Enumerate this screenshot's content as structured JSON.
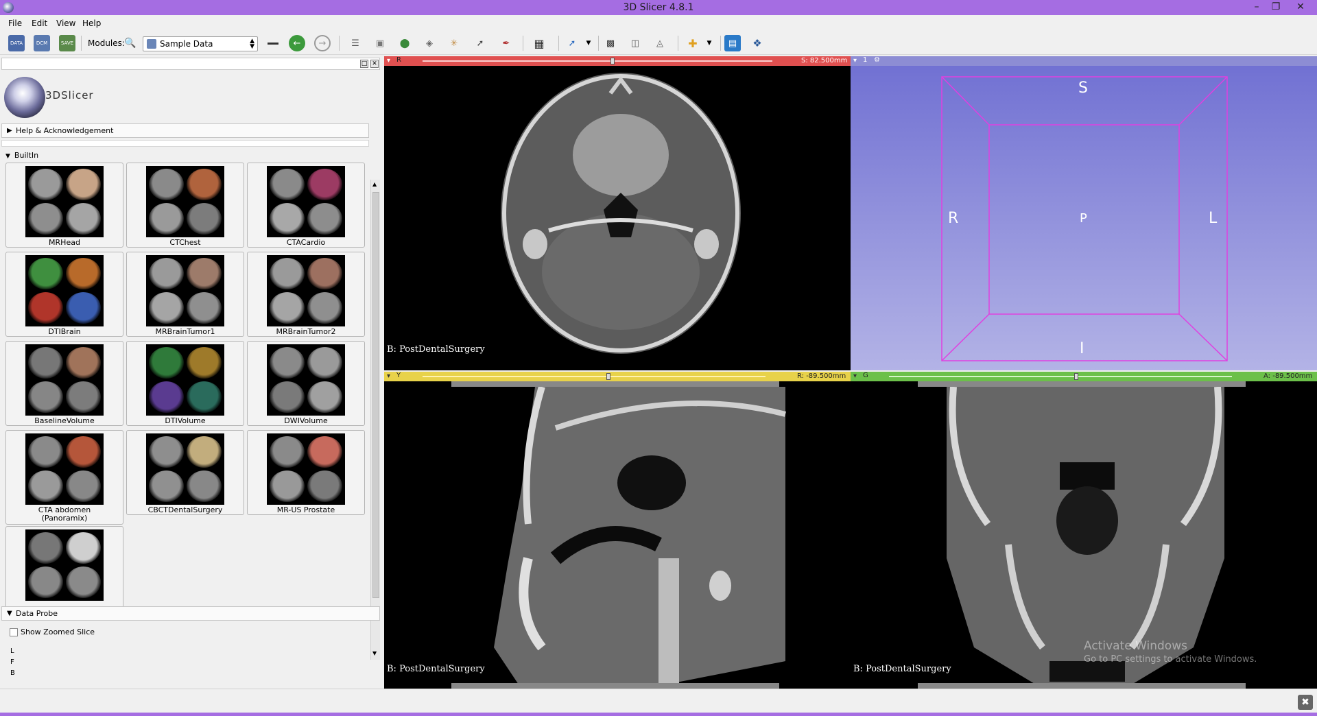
{
  "window": {
    "title": "3D Slicer 4.8.1"
  },
  "menu": [
    "File",
    "Edit",
    "View",
    "Help"
  ],
  "toolbar": {
    "modules_label": "Modules:",
    "module_selected": "Sample Data"
  },
  "logo_text": "3DSlicer",
  "sections": {
    "help": "Help & Acknowledgement",
    "builtin": "BuiltIn",
    "data_probe": "Data Probe"
  },
  "samples": [
    {
      "label": "MRHead",
      "colors": [
        "#9a9a9a",
        "#c7a487",
        "#8e8e8e",
        "#a5a5a5"
      ]
    },
    {
      "label": "CTChest",
      "colors": [
        "#8a8a8a",
        "#b0633d",
        "#9a9a9a",
        "#7c7c7c"
      ]
    },
    {
      "label": "CTACardio",
      "colors": [
        "#8a8a8a",
        "#9c3b63",
        "#a8a8a8",
        "#8d8d8d"
      ]
    },
    {
      "label": "DTIBrain",
      "colors": [
        "#3f8f3f",
        "#b86a2a",
        "#b0352a",
        "#3a5db0"
      ]
    },
    {
      "label": "MRBrainTumor1",
      "colors": [
        "#9a9a9a",
        "#9d7b6a",
        "#a5a5a5",
        "#8f8f8f"
      ]
    },
    {
      "label": "MRBrainTumor2",
      "colors": [
        "#9a9a9a",
        "#9d7060",
        "#a5a5a5",
        "#8f8f8f"
      ]
    },
    {
      "label": "BaselineVolume",
      "colors": [
        "#777",
        "#a0735a",
        "#868686",
        "#7c7c7c"
      ]
    },
    {
      "label": "DTIVolume",
      "colors": [
        "#2f7a3a",
        "#9e7a2a",
        "#5a3b90",
        "#2a6b5c"
      ]
    },
    {
      "label": "DWIVolume",
      "colors": [
        "#8a8a8a",
        "#9a9a9a",
        "#7a7a7a",
        "#a0a0a0"
      ]
    },
    {
      "label": "CTA abdomen\n(Panoramix)",
      "colors": [
        "#8a8a8a",
        "#b5563a",
        "#9a9a9a",
        "#888"
      ]
    },
    {
      "label": "CBCTDentalSurgery",
      "colors": [
        "#8e8e8e",
        "#c2ad7d",
        "#909090",
        "#888"
      ]
    },
    {
      "label": "MR-US Prostate",
      "colors": [
        "#8a8a8a",
        "#c76a5d",
        "#999",
        "#7a7a7a"
      ]
    },
    {
      "label": "",
      "colors": [
        "#777",
        "#cfcfcf",
        "#888",
        "#8a8a8a"
      ]
    }
  ],
  "data_probe": {
    "show_zoomed": "Show Zoomed Slice",
    "rows": [
      "L",
      "F",
      "B"
    ]
  },
  "views": {
    "red": {
      "letter": "R",
      "offset": "S: 82.500mm",
      "label": "B: PostDentalSurgery",
      "color": "#e05050"
    },
    "threed": {
      "number": "1",
      "labels": {
        "S": "S",
        "R": "R",
        "P": "P",
        "L": "L",
        "I": "I"
      },
      "color": "#c8c8ff"
    },
    "yellow": {
      "letter": "Y",
      "offset": "R: -89.500mm",
      "label": "B: PostDentalSurgery",
      "color": "#e8d24a"
    },
    "green": {
      "letter": "G",
      "offset": "A: -89.500mm",
      "label": "B: PostDentalSurgery",
      "color": "#6cc04a"
    }
  },
  "watermark": {
    "line1": "Activate Windows",
    "line2": "Go to PC settings to activate Windows."
  }
}
